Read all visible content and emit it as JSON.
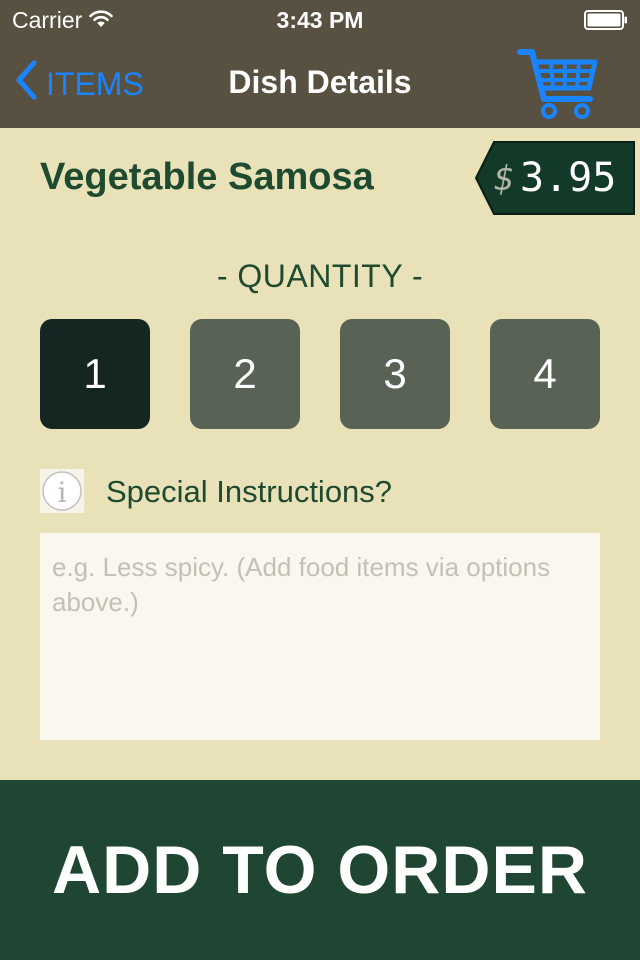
{
  "status_bar": {
    "carrier": "Carrier",
    "time": "3:43 PM",
    "wifi_icon": "wifi-icon",
    "battery_icon": "battery-icon"
  },
  "nav": {
    "back_label": "ITEMS",
    "back_icon": "chevron-left-icon",
    "title": "Dish Details",
    "cart_icon": "shopping-cart-icon"
  },
  "dish": {
    "name": "Vegetable Samosa",
    "price_currency": "$",
    "price_value": "3.95"
  },
  "quantity": {
    "label": "- QUANTITY -",
    "options": [
      "1",
      "2",
      "3",
      "4"
    ],
    "selected": "1"
  },
  "instructions": {
    "info_icon": "info-icon",
    "label": "Special Instructions?",
    "placeholder": "e.g. Less spicy. (Add food items via options above.)",
    "value": ""
  },
  "actions": {
    "add_to_order_label": "ADD TO ORDER"
  },
  "colors": {
    "header_bg": "#585141",
    "page_bg": "#e9e2b9",
    "accent_blue": "#1a84ff",
    "text_green": "#1e4a30",
    "qty_selected": "#152521",
    "qty_unselected": "#586356",
    "button_bg": "#1e4632",
    "price_tag_bg": "#133a29"
  }
}
